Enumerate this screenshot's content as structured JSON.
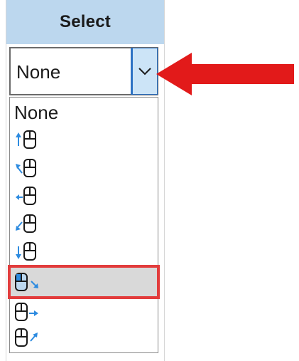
{
  "header": {
    "title": "Select"
  },
  "combo": {
    "value": "None",
    "button_icon": "chevron-down-icon"
  },
  "options": [
    {
      "label": "None",
      "icon": "none"
    },
    {
      "label": "",
      "icon": "mouse-arrow-up-icon"
    },
    {
      "label": "",
      "icon": "mouse-arrow-up-left-icon"
    },
    {
      "label": "",
      "icon": "mouse-arrow-left-icon"
    },
    {
      "label": "",
      "icon": "mouse-arrow-down-left-icon"
    },
    {
      "label": "",
      "icon": "mouse-arrow-down-icon"
    },
    {
      "label": "",
      "icon": "mouse-arrow-down-right-icon",
      "selected": true
    },
    {
      "label": "",
      "icon": "mouse-arrow-right-icon"
    },
    {
      "label": "",
      "icon": "mouse-arrow-up-right-icon"
    }
  ],
  "annotations": {
    "arrow_color": "#e21a1a",
    "highlight_color": "#e23c3c"
  },
  "colors": {
    "header_bg": "#bcd7ee",
    "arrow_blue": "#2d8be0",
    "button_bg": "#cce4f7"
  }
}
